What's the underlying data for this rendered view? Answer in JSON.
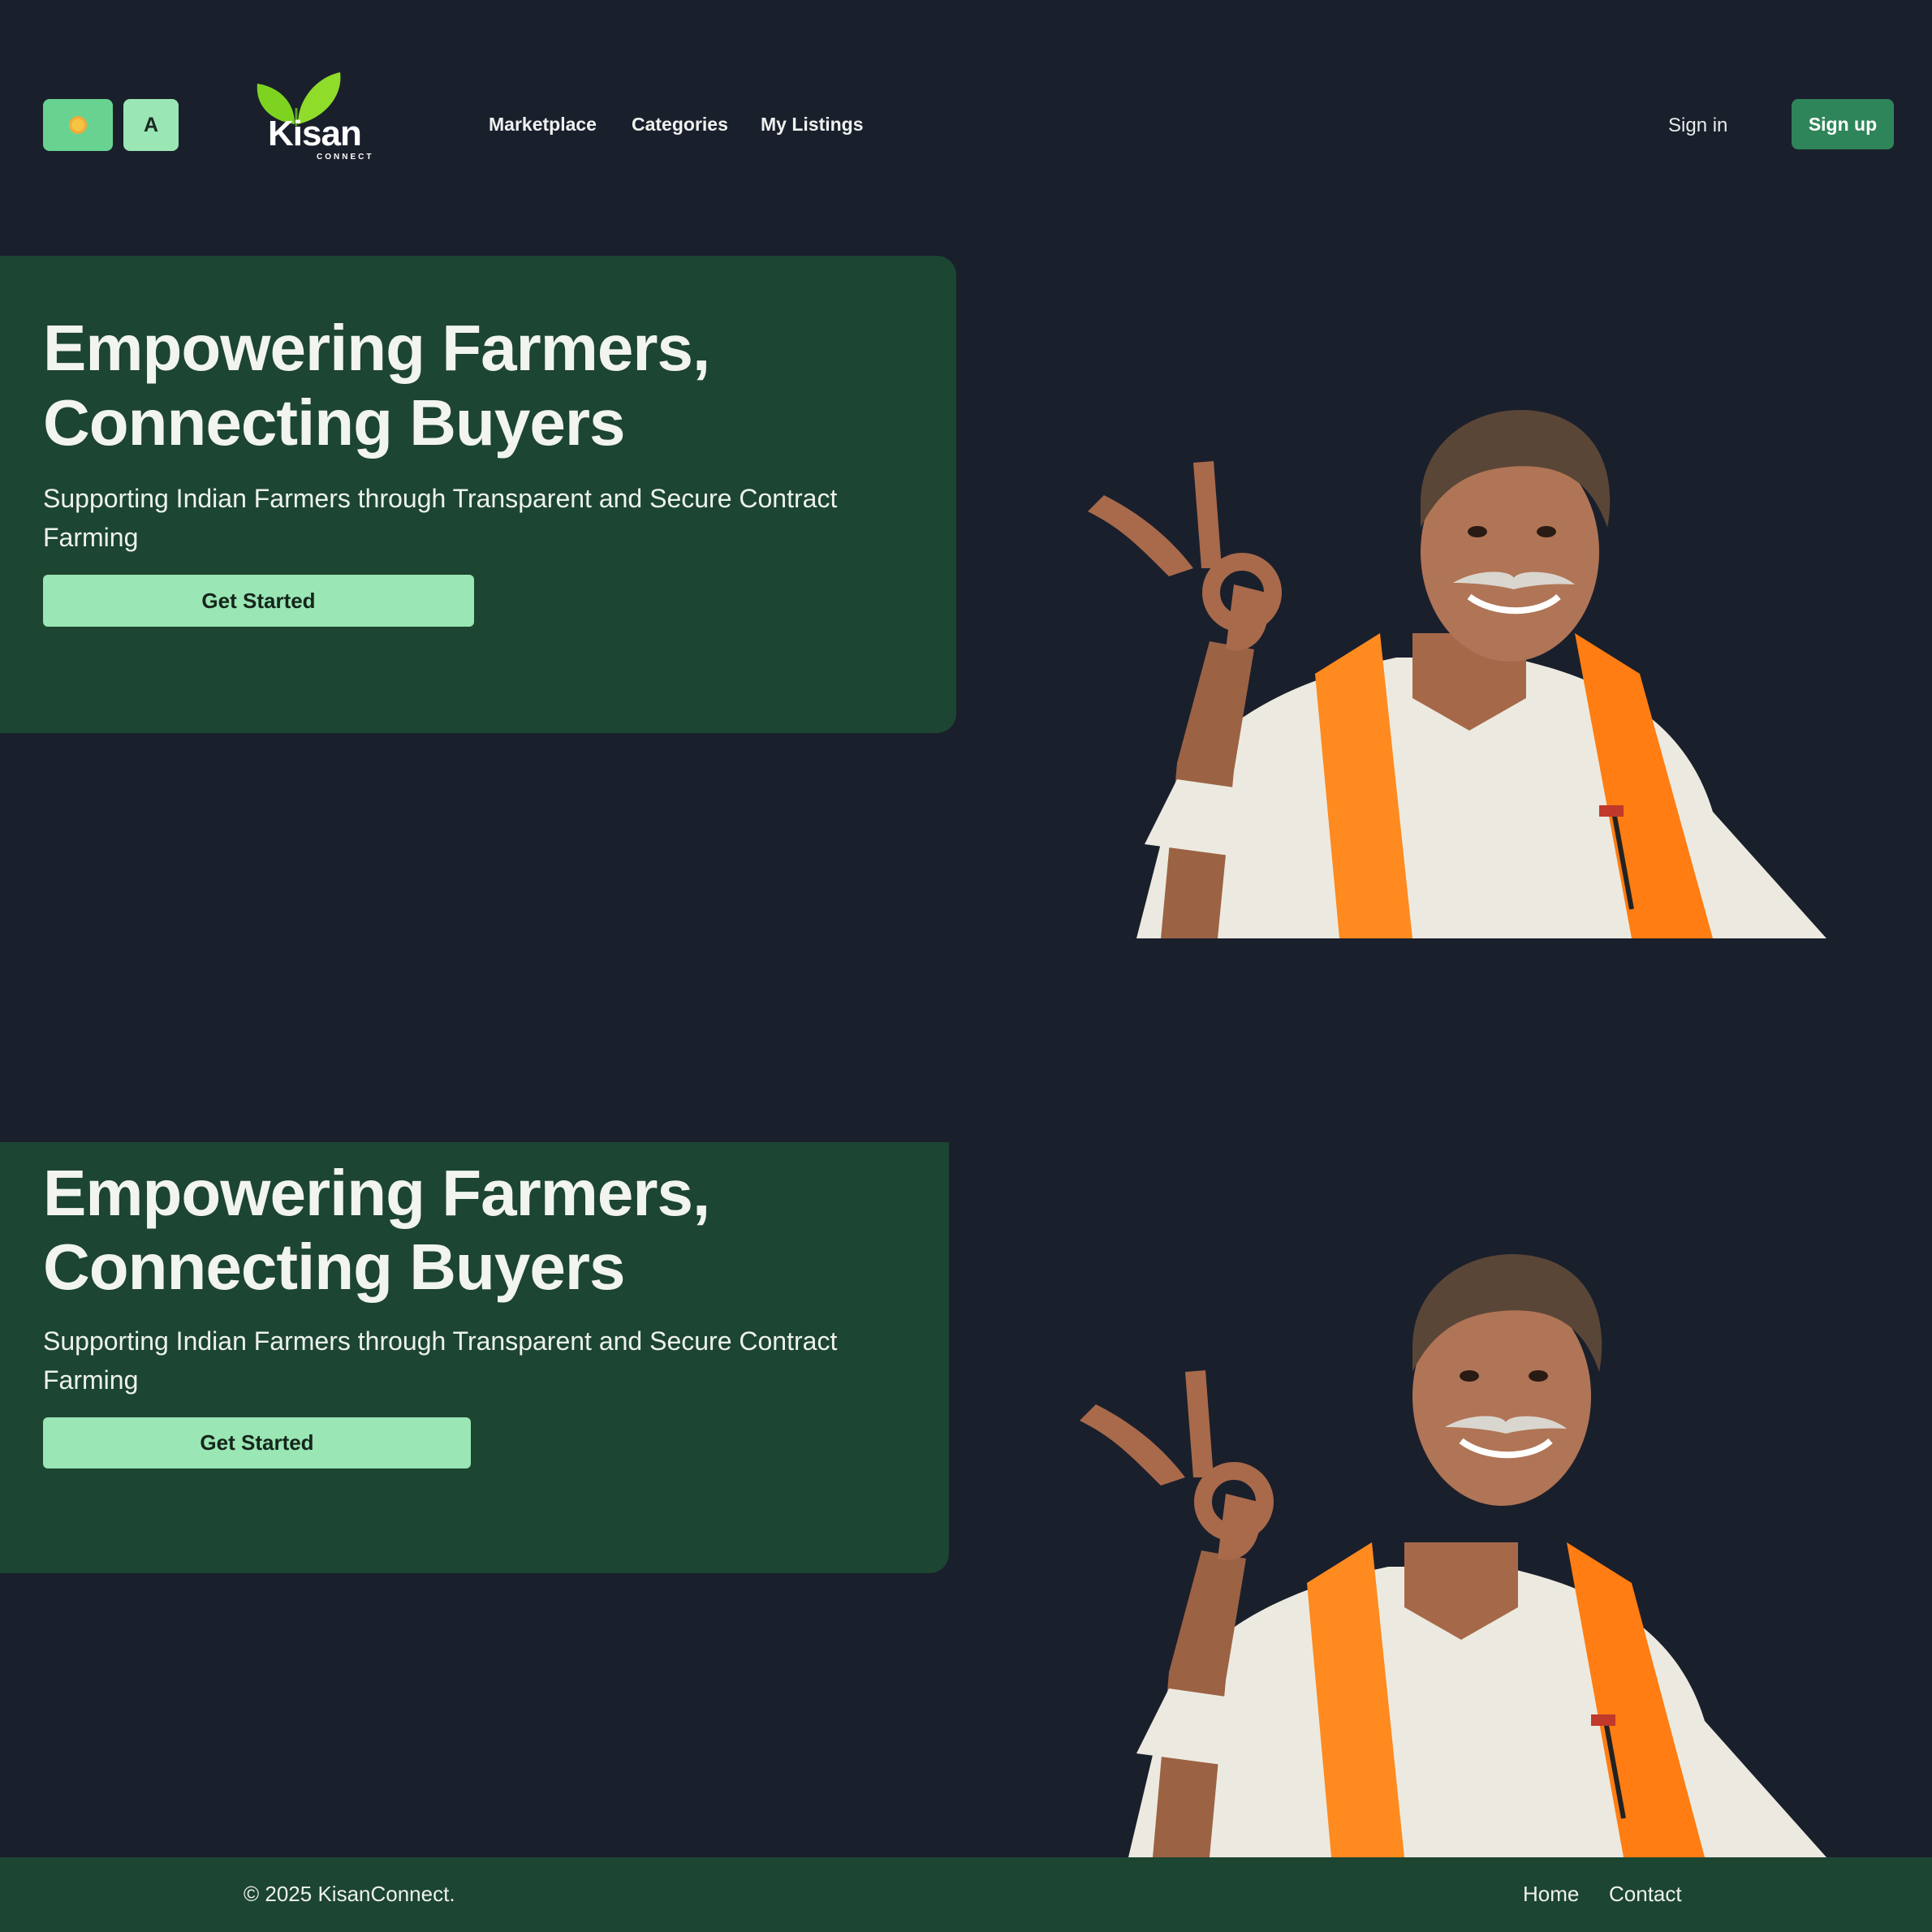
{
  "header": {
    "theme_toggle_icon": "sun-icon",
    "language_label": "A",
    "logo": {
      "word": "Kisan",
      "sub": "CONNECT",
      "icon": "leaf-icon"
    },
    "nav": [
      {
        "label": "Marketplace"
      },
      {
        "label": "Categories"
      },
      {
        "label": "My Listings"
      }
    ],
    "signin_label": "Sign in",
    "signup_label": "Sign up"
  },
  "hero": {
    "title_line1": "Empowering Farmers,",
    "title_line2": "Connecting Buyers",
    "subtitle_line1": "Supporting Indian Farmers through Transparent and Secure Contract",
    "subtitle_line2": "Farming",
    "cta_label": "Get Started",
    "image": "farmer-photo"
  },
  "hero_repeat": {
    "title_line1": "Empowering Farmers,",
    "title_line2": "Connecting Buyers",
    "subtitle_line1": "Supporting Indian Farmers through Transparent and Secure Contract",
    "subtitle_line2": "Farming",
    "cta_label": "Get Started",
    "image": "farmer-photo"
  },
  "footer": {
    "copyright": "© 2025 KisanConnect.",
    "links": [
      {
        "label": "Home"
      },
      {
        "label": "Contact"
      }
    ]
  },
  "colors": {
    "background": "#1a1f2c",
    "panel": "#1c4532",
    "accent_light": "#9ae6b4",
    "accent": "#68d391",
    "signup": "#2f855a",
    "scarf": "#ff8a1f"
  }
}
